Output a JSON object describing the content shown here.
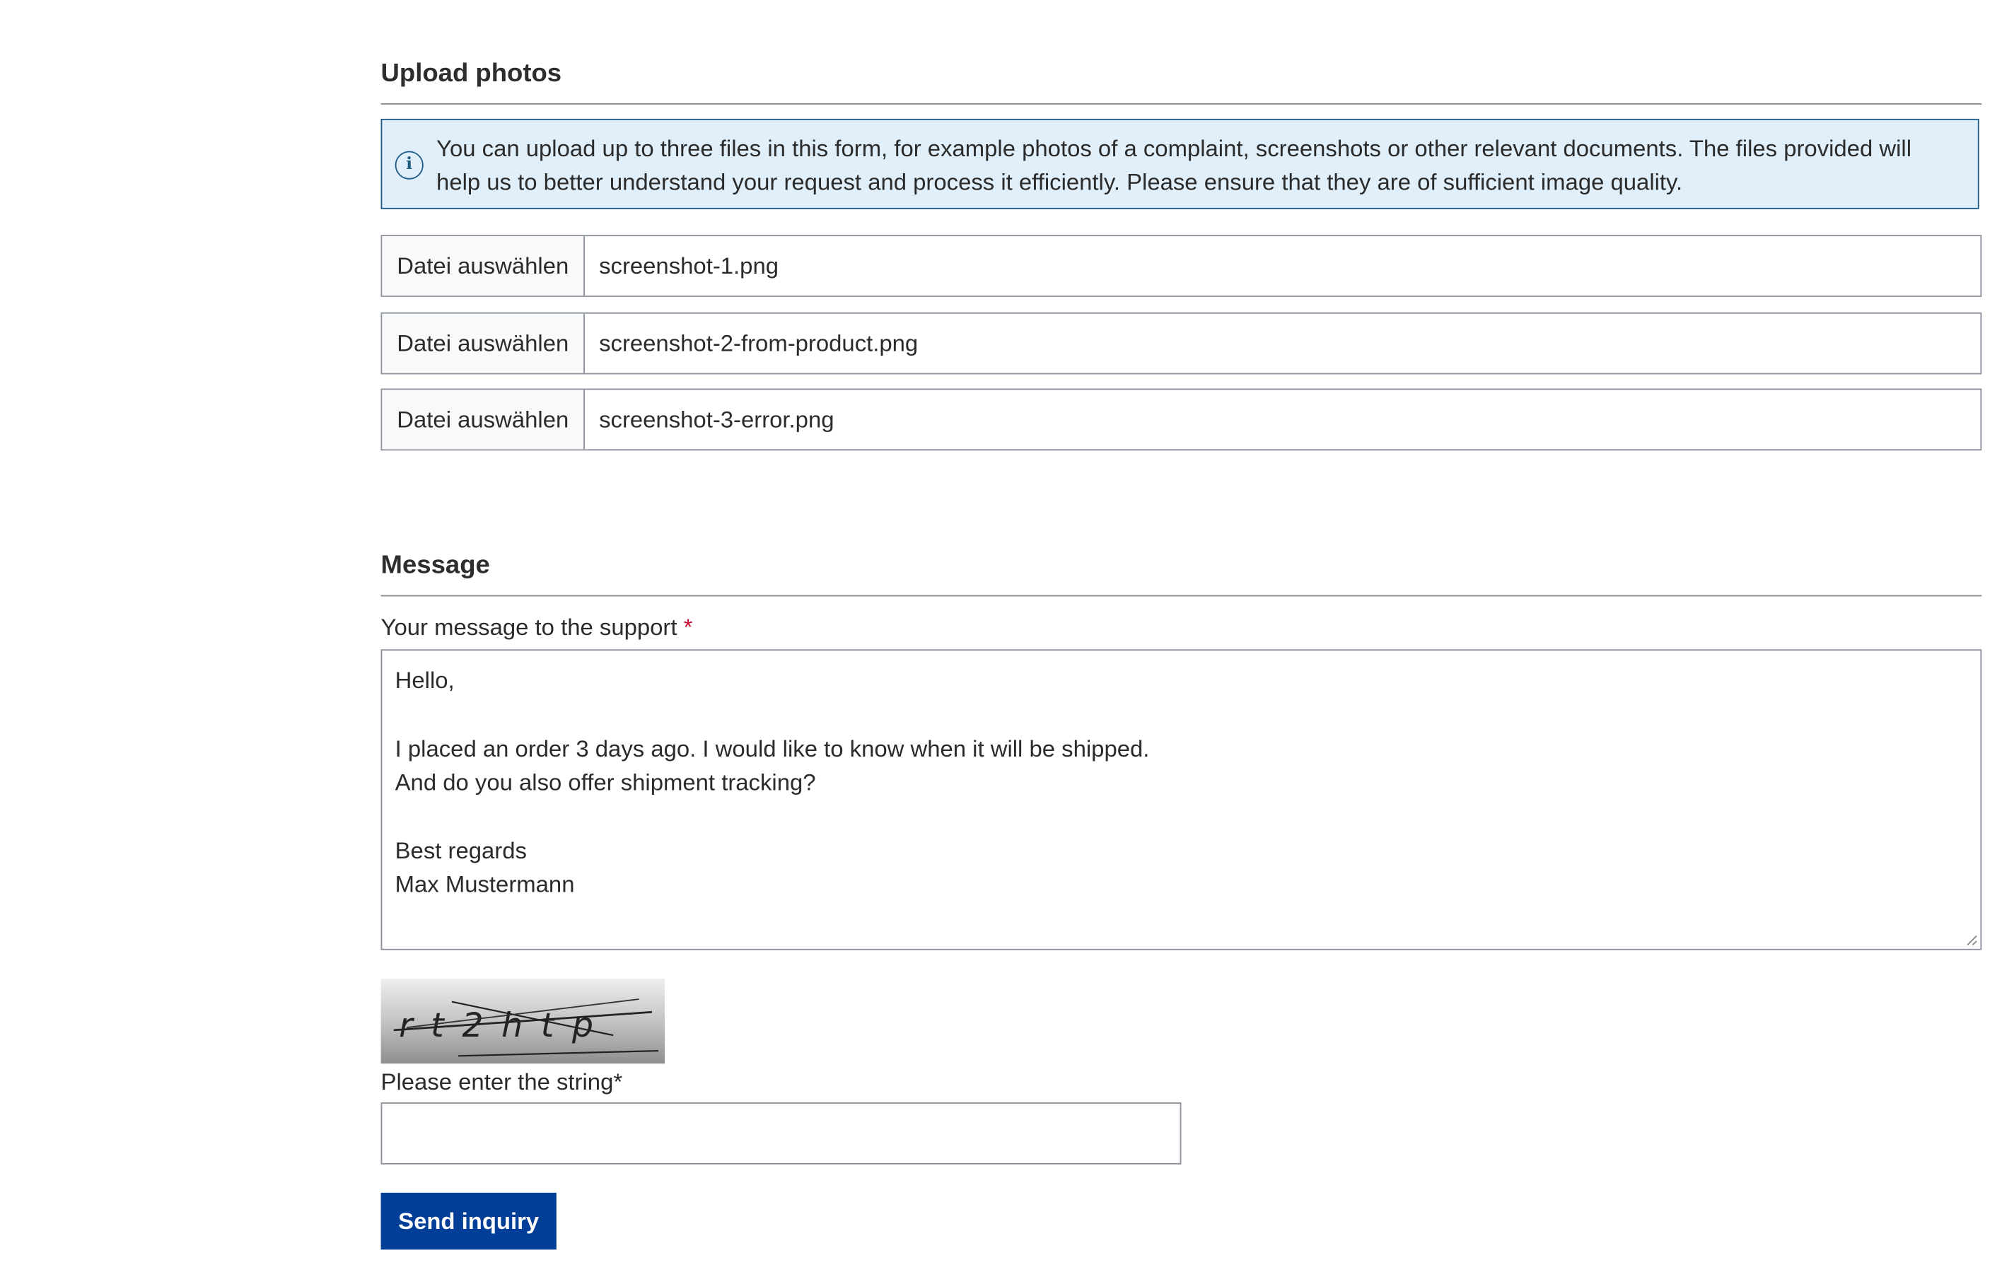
{
  "upload": {
    "title": "Upload photos",
    "info_icon": "info-icon",
    "info_text": "You can upload up to three files in this form, for example photos of a complaint, screenshots or other relevant documents. The files provided will help us to better understand your request and process it efficiently. Please ensure that they are of sufficient image quality.",
    "files": [
      {
        "button_label": "Datei auswählen",
        "file_name": "screenshot-1.png"
      },
      {
        "button_label": "Datei auswählen",
        "file_name": "screenshot-2-from-product.png"
      },
      {
        "button_label": "Datei auswählen",
        "file_name": "screenshot-3-error.png"
      }
    ]
  },
  "message": {
    "title": "Message",
    "label": "Your message to the support",
    "required_mark": "*",
    "lines": [
      "Hello,",
      "",
      "I placed an order 3 days ago. I would like to know when it will be shipped.",
      "And do you also offer shipment tracking?",
      "",
      "Best regards",
      "Max Mustermann"
    ]
  },
  "captcha": {
    "image_text": "rt2htp",
    "label": "Please enter the string*",
    "value": ""
  },
  "submit": {
    "label": "Send inquiry"
  },
  "colors": {
    "info_bg": "#e0eff9",
    "info_border": "#1f5b86",
    "button_bg": "#003e98",
    "required": "#c8102e"
  }
}
